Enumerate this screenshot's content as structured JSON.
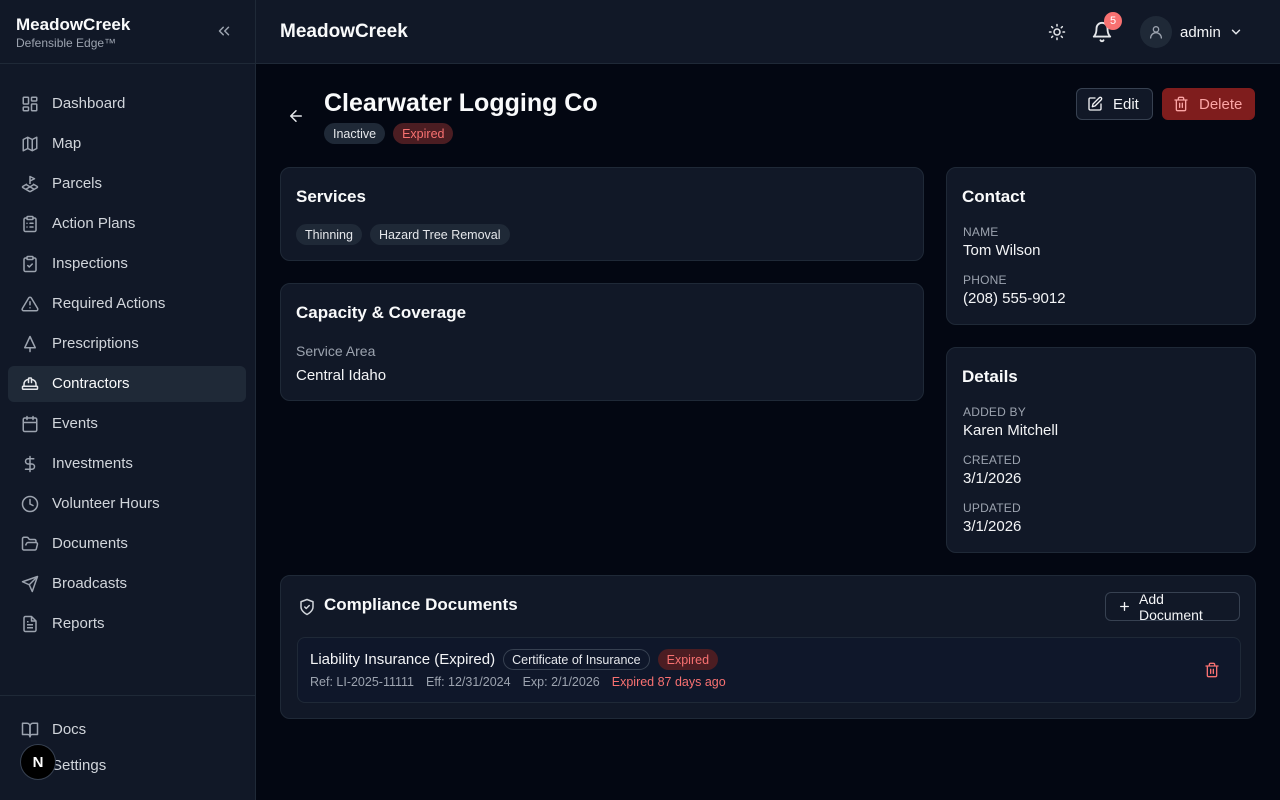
{
  "sidebar": {
    "brand_name": "MeadowCreek",
    "brand_tagline": "Defensible Edge™",
    "items": [
      {
        "label": "Dashboard"
      },
      {
        "label": "Map"
      },
      {
        "label": "Parcels"
      },
      {
        "label": "Action Plans"
      },
      {
        "label": "Inspections"
      },
      {
        "label": "Required Actions"
      },
      {
        "label": "Prescriptions"
      },
      {
        "label": "Contractors",
        "active": true
      },
      {
        "label": "Events"
      },
      {
        "label": "Investments"
      },
      {
        "label": "Volunteer Hours"
      },
      {
        "label": "Documents"
      },
      {
        "label": "Broadcasts"
      },
      {
        "label": "Reports"
      }
    ],
    "bottom_items": [
      {
        "label": "Docs"
      },
      {
        "label": "Settings"
      }
    ],
    "fab_label": "N"
  },
  "topbar": {
    "title": "MeadowCreek",
    "notification_count": "5",
    "username": "admin"
  },
  "page": {
    "title": "Clearwater Logging Co",
    "status_badges": [
      "Inactive",
      "Expired"
    ],
    "edit_label": "Edit",
    "delete_label": "Delete"
  },
  "services": {
    "title": "Services",
    "items": [
      "Thinning",
      "Hazard Tree Removal"
    ]
  },
  "capacity": {
    "title": "Capacity & Coverage",
    "service_area_label": "Service Area",
    "service_area_value": "Central Idaho"
  },
  "contact": {
    "title": "Contact",
    "name_label": "NAME",
    "name_value": "Tom Wilson",
    "phone_label": "PHONE",
    "phone_value": "(208) 555-9012"
  },
  "details": {
    "title": "Details",
    "added_by_label": "ADDED BY",
    "added_by_value": "Karen Mitchell",
    "created_label": "CREATED",
    "created_value": "3/1/2026",
    "updated_label": "UPDATED",
    "updated_value": "3/1/2026"
  },
  "compliance": {
    "title": "Compliance Documents",
    "add_label": "Add Document",
    "documents": [
      {
        "name": "Liability Insurance (Expired)",
        "type": "Certificate of Insurance",
        "status": "Expired",
        "ref": "Ref: LI-2025-11111",
        "effective": "Eff: 12/31/2024",
        "expires": "Exp: 2/1/2026",
        "expired_note": "Expired 87 days ago"
      }
    ]
  },
  "colors": {
    "background": "#030712",
    "surface": "#111827",
    "danger": "#f87171",
    "danger_bg": "#7f1d1d"
  }
}
